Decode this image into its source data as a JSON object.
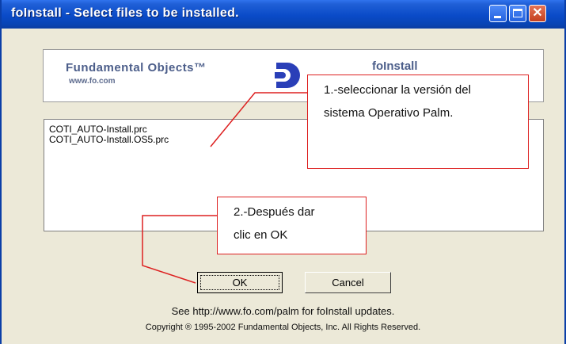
{
  "window": {
    "title": "foInstall - Select files to be installed.",
    "close_glyph": "✕"
  },
  "banner": {
    "brand": "Fundamental Objects™",
    "url": "www.fo.com",
    "product": "foInstall"
  },
  "file_list": {
    "items": [
      "COTI_AUTO-Install.prc",
      "COTI_AUTO-Install.OS5.prc"
    ]
  },
  "buttons": {
    "ok": "OK",
    "cancel": "Cancel"
  },
  "footer": {
    "line1": "See http://www.fo.com/palm for foInstall updates.",
    "line2": "Copyright ® 1995-2002 Fundamental Objects, Inc. All Rights Reserved."
  },
  "callouts": {
    "step1": [
      "1.-seleccionar la versión del",
      "sistema Operativo  Palm."
    ],
    "step2": [
      "2.-Después dar",
      "clic  en OK"
    ]
  },
  "colors": {
    "titlebar": "#0a4bc8",
    "callout_border": "#dd2020",
    "window_face": "#ece9d8"
  },
  "icons": [
    "minimize-icon",
    "maximize-icon",
    "close-icon",
    "fo-logo-icon"
  ]
}
